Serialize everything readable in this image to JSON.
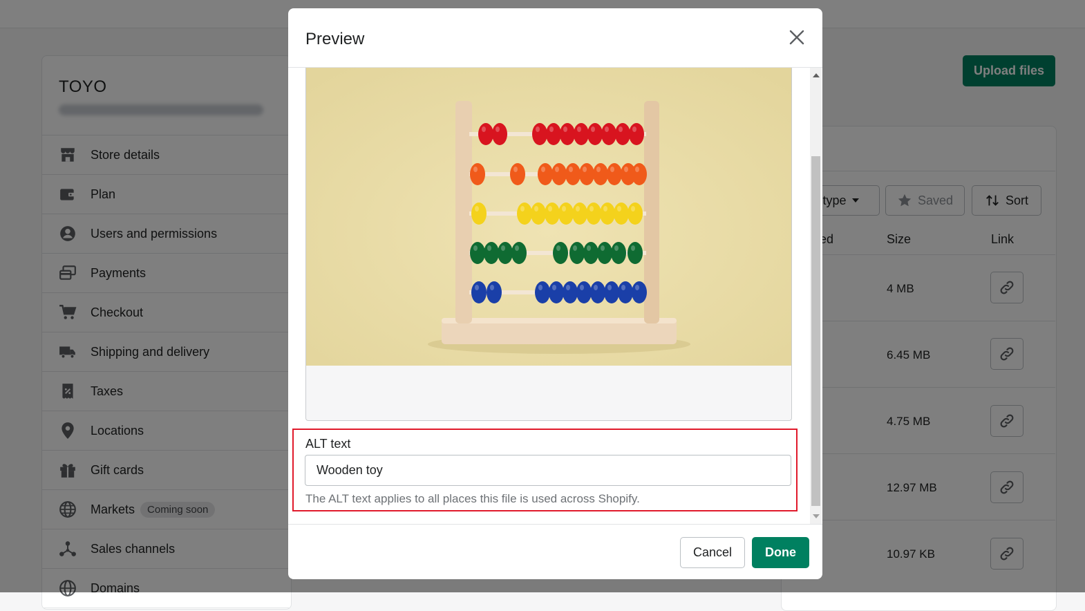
{
  "store": {
    "name": "TOYO",
    "menu": [
      {
        "label": "Store details"
      },
      {
        "label": "Plan"
      },
      {
        "label": "Users and permissions"
      },
      {
        "label": "Payments"
      },
      {
        "label": "Checkout"
      },
      {
        "label": "Shipping and delivery"
      },
      {
        "label": "Taxes"
      },
      {
        "label": "Locations"
      },
      {
        "label": "Gift cards"
      },
      {
        "label": "Markets",
        "badge": "Coming soon"
      },
      {
        "label": "Sales channels"
      },
      {
        "label": "Domains"
      }
    ]
  },
  "files": {
    "upload_label": "Upload files",
    "filter_type_label": "type",
    "saved_label": "Saved",
    "sort_label": "Sort",
    "col_partial": "ed",
    "col_size": "Size",
    "col_link": "Link",
    "rows": [
      {
        "size": "4 MB"
      },
      {
        "size": "6.45 MB"
      },
      {
        "size": "4.75 MB"
      },
      {
        "size": "12.97 MB"
      },
      {
        "size": "10.97 KB"
      }
    ]
  },
  "modal": {
    "title": "Preview",
    "alt_label": "ALT text",
    "alt_value": "Wooden toy",
    "alt_help": "The ALT text applies to all places this file is used across Shopify.",
    "cancel_label": "Cancel",
    "done_label": "Done"
  },
  "colors": {
    "primary": "#008060",
    "highlight": "#e0192a",
    "bead_rows": [
      "#d8141f",
      "#f05a1a",
      "#f4d21c",
      "#0f6b32",
      "#1a3fa8"
    ]
  }
}
